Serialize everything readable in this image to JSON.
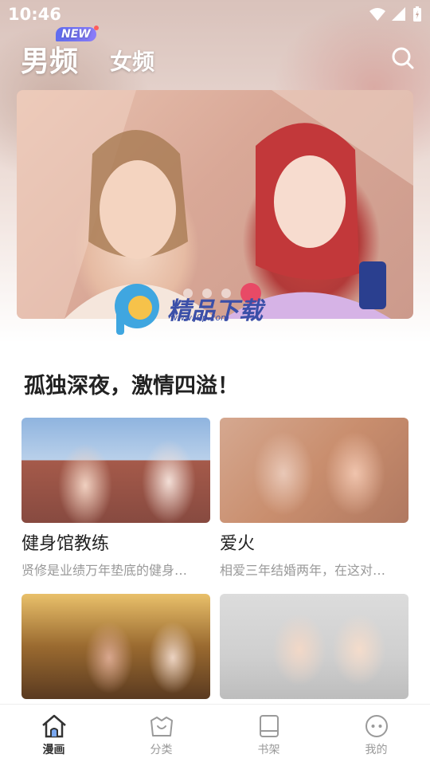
{
  "status": {
    "time": "10:46"
  },
  "header": {
    "tabs": [
      {
        "label": "男频",
        "badge": "NEW",
        "active": true
      },
      {
        "label": "女频",
        "active": false
      }
    ]
  },
  "banner": {
    "slides": 5,
    "active_index": 3
  },
  "watermark": {
    "text": "精品下载",
    "url": "www.j9p.com"
  },
  "section": {
    "title": "孤独深夜，激情四溢！"
  },
  "cards": [
    {
      "title": "健身馆教练",
      "desc": "贤修是业绩万年垫底的健身…"
    },
    {
      "title": "爱火",
      "desc": "相爱三年结婚两年，在这对…"
    },
    {
      "title": "",
      "desc": ""
    },
    {
      "title": "",
      "desc": ""
    }
  ],
  "nav": {
    "items": [
      {
        "label": "漫画",
        "icon": "home-icon",
        "active": true
      },
      {
        "label": "分类",
        "icon": "category-icon",
        "active": false
      },
      {
        "label": "书架",
        "icon": "bookshelf-icon",
        "active": false
      },
      {
        "label": "我的",
        "icon": "profile-icon",
        "active": false
      }
    ]
  },
  "colors": {
    "accent": "#e84a66",
    "text": "#222222",
    "muted": "#999999"
  }
}
